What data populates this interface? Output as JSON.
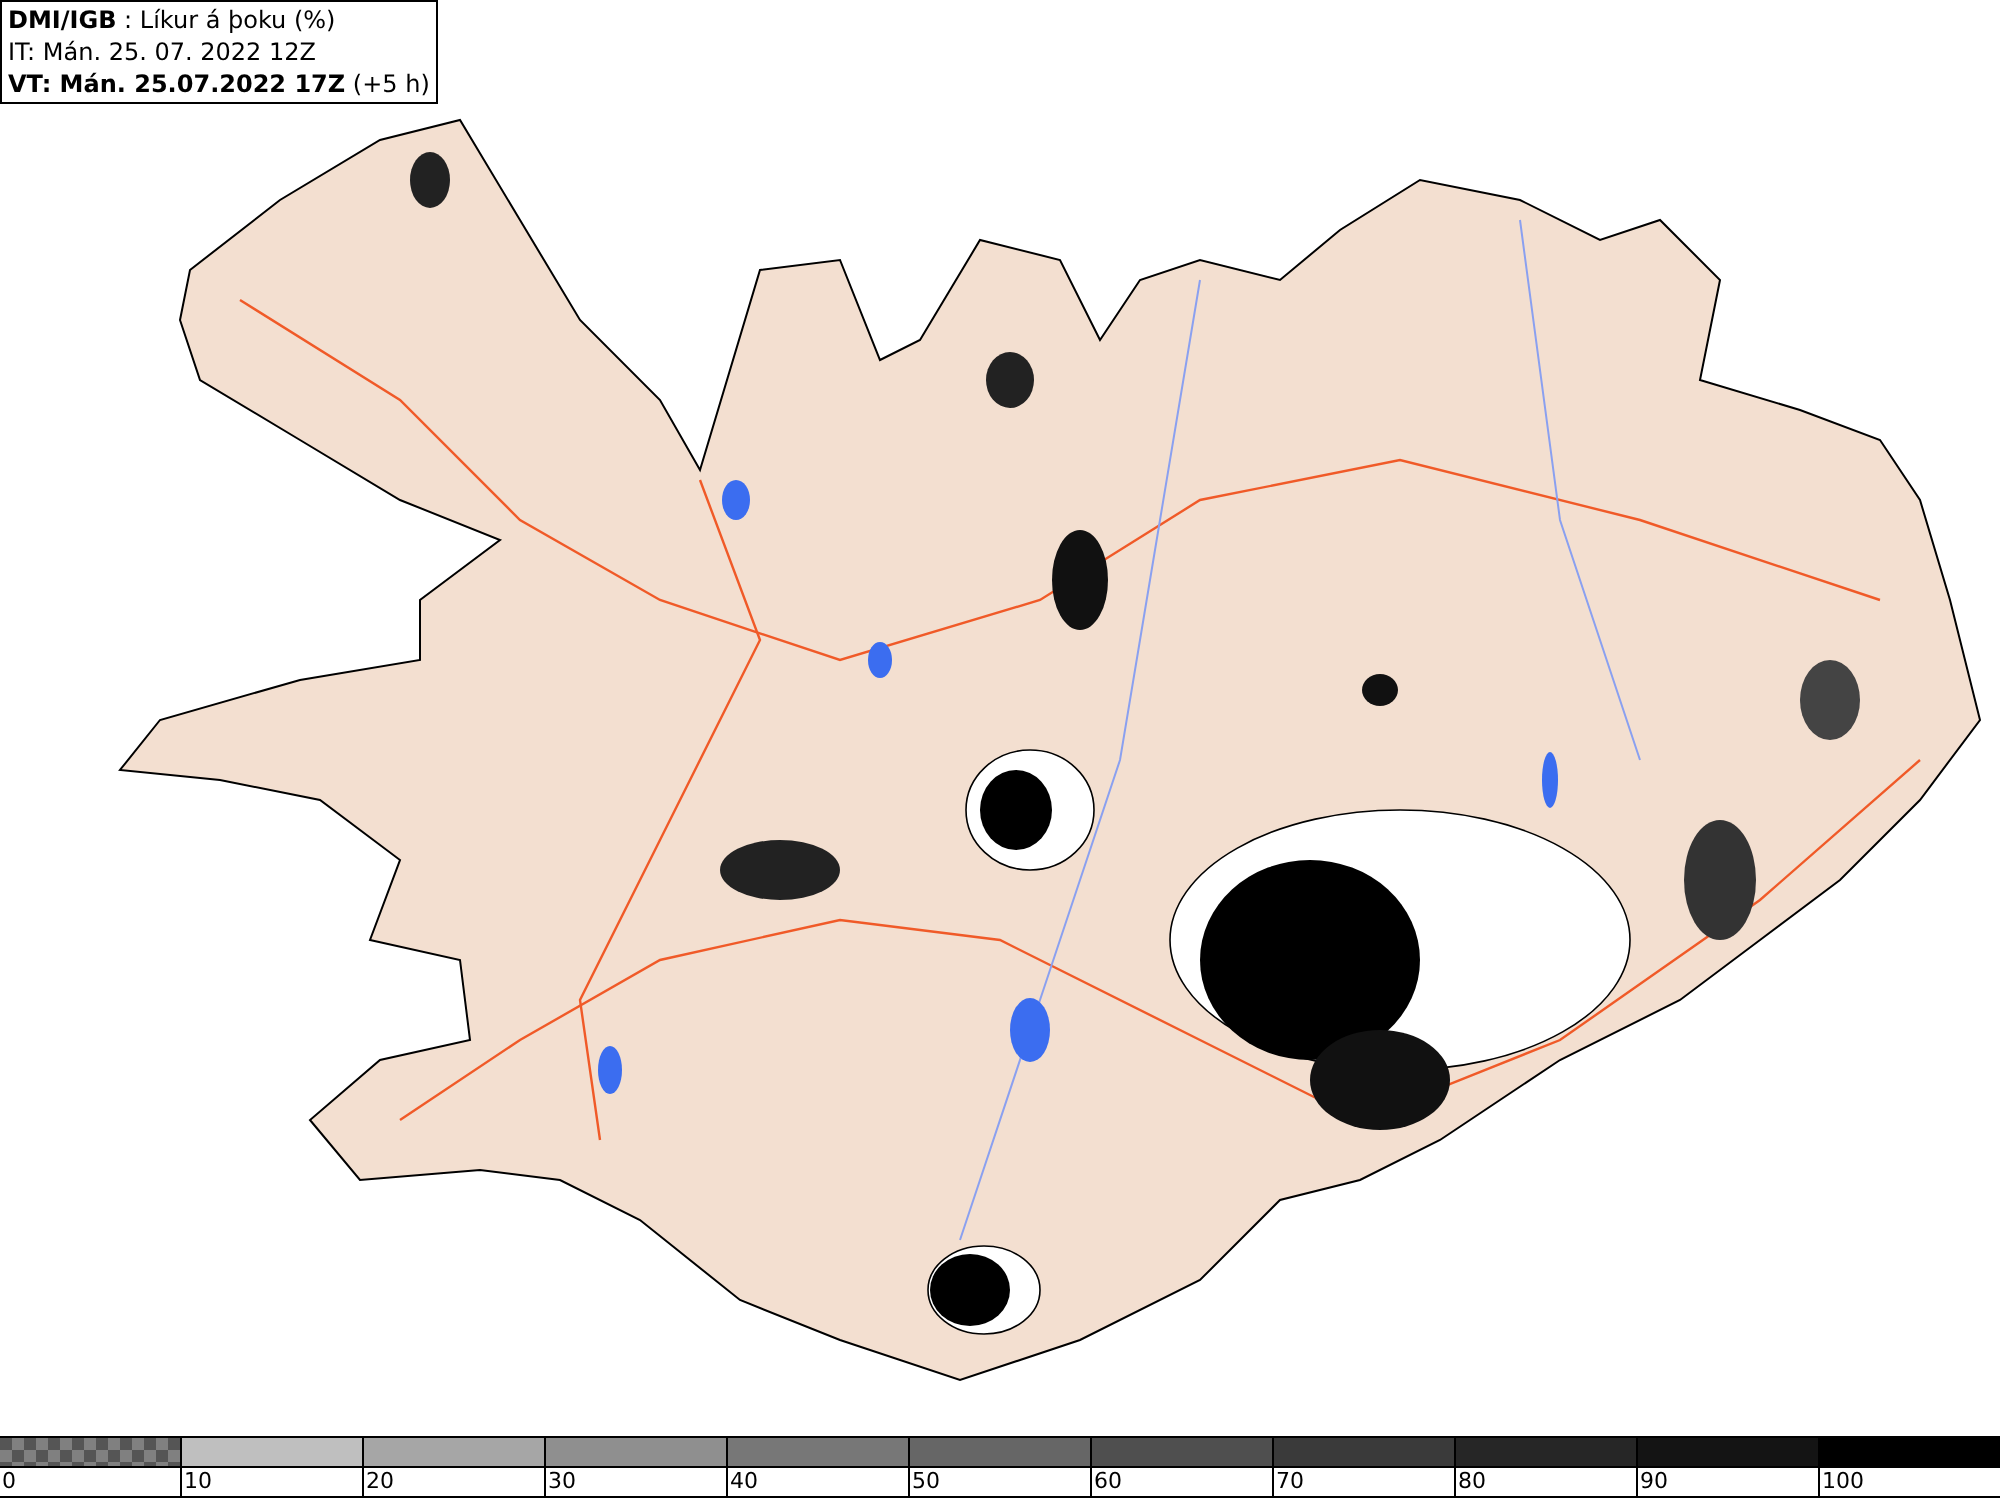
{
  "header": {
    "lines": [
      "**DMI/IGB** : Líkur á þoku (%)",
      "IT: Mán. 25. 07. 2022 12Z",
      "**VT: Mán. 25.07.2022 17Z** (+5 h)"
    ]
  },
  "legend": {
    "bins": [
      {
        "kind": "checker",
        "color": "#808080",
        "label": "0"
      },
      {
        "kind": "solid",
        "color": "#bfbfbf",
        "label": "10"
      },
      {
        "kind": "solid",
        "color": "#a6a6a6",
        "label": "20"
      },
      {
        "kind": "solid",
        "color": "#8f8f8f",
        "label": "30"
      },
      {
        "kind": "solid",
        "color": "#777777",
        "label": "40"
      },
      {
        "kind": "solid",
        "color": "#666666",
        "label": "50"
      },
      {
        "kind": "solid",
        "color": "#4f4f4f",
        "label": "60"
      },
      {
        "kind": "solid",
        "color": "#3a3a3a",
        "label": "70"
      },
      {
        "kind": "solid",
        "color": "#262626",
        "label": "80"
      },
      {
        "kind": "solid",
        "color": "#141414",
        "label": "90"
      },
      {
        "kind": "solid",
        "color": "#000000",
        "label": "100"
      }
    ]
  }
}
